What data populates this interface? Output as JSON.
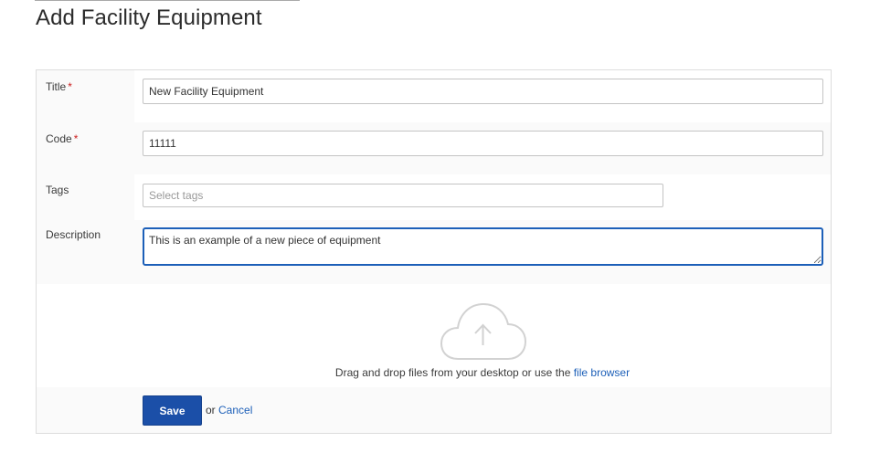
{
  "page": {
    "title": "Add Facility Equipment"
  },
  "form": {
    "title_field": {
      "label": "Title",
      "required_mark": "*",
      "value": "New Facility Equipment"
    },
    "code_field": {
      "label": "Code",
      "required_mark": "*",
      "value": "11111"
    },
    "tags_field": {
      "label": "Tags",
      "placeholder": "Select tags",
      "value": ""
    },
    "description_field": {
      "label": "Description",
      "value": "This is an example of a new piece of equipment"
    },
    "upload": {
      "icon": "cloud-upload-icon",
      "text": "Drag and drop files from your desktop or use the",
      "link_label": "file browser"
    },
    "actions": {
      "save_label": "Save",
      "or_text": "or",
      "cancel_label": "Cancel"
    }
  },
  "colors": {
    "accent": "#1c5fb8",
    "save_bg": "#1b4fa8",
    "required": "#cc1f1f"
  }
}
